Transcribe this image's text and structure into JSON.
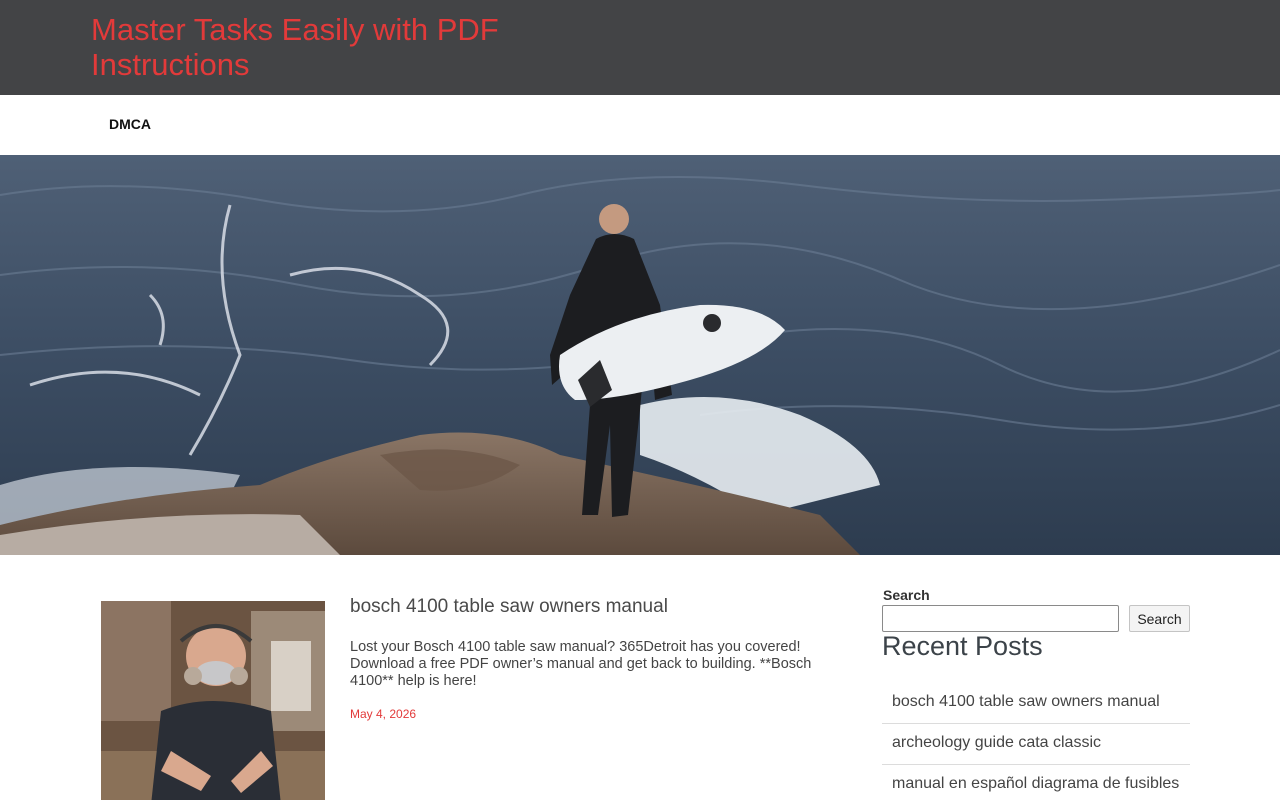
{
  "site": {
    "title": "Master Tasks Easily with PDF Instructions",
    "accent_color": "#e23a3a",
    "header_bg": "#434446"
  },
  "nav": {
    "items": [
      {
        "label": "DMCA"
      }
    ]
  },
  "hero": {
    "image": "surfer-on-rocks-photo"
  },
  "post": {
    "title": "bosch 4100 table saw owners manual",
    "excerpt": "Lost your Bosch 4100 table saw manual? 365Detroit has you covered! Download a free PDF owner’s manual and get back to building. **Bosch 4100** help is here!",
    "date": "May 4, 2026",
    "thumbnail": "woodworker-with-respirator-photo"
  },
  "sidebar": {
    "search_label": "Search",
    "search_value": "",
    "search_button": "Search",
    "recent_heading": "Recent Posts",
    "recent_posts": [
      {
        "label": "bosch 4100 table saw owners manual"
      },
      {
        "label": "archeology guide cata classic"
      },
      {
        "label": "manual en español diagrama de fusibles"
      }
    ]
  }
}
